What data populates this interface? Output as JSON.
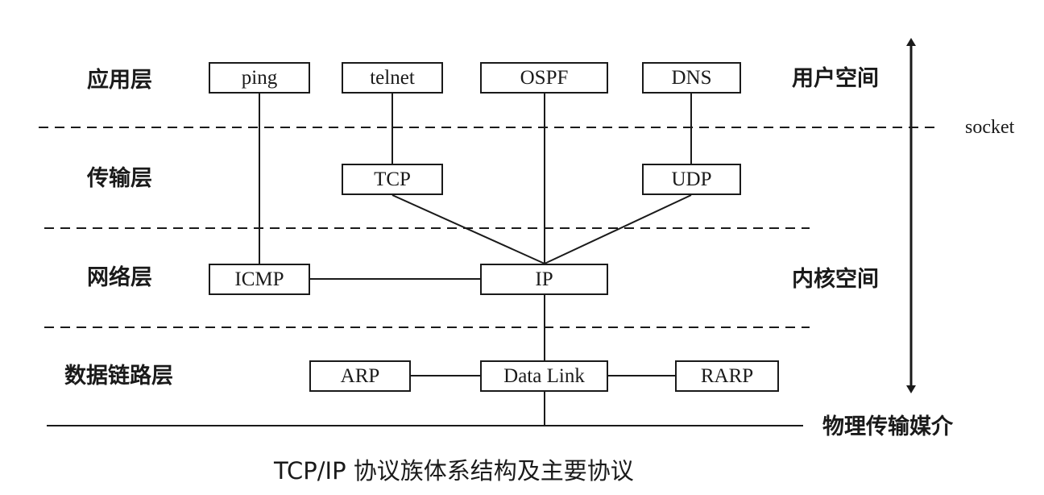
{
  "layers": {
    "application": "应用层",
    "transport": "传输层",
    "network": "网络层",
    "datalink": "数据链路层"
  },
  "side_labels": {
    "user_space": "用户空间",
    "socket": "socket",
    "kernel_space": "内核空间",
    "physical_medium": "物理传输媒介"
  },
  "boxes": {
    "ping": "ping",
    "telnet": "telnet",
    "ospf": "OSPF",
    "dns": "DNS",
    "tcp": "TCP",
    "udp": "UDP",
    "icmp": "ICMP",
    "ip": "IP",
    "arp": "ARP",
    "datalink": "Data Link",
    "rarp": "RARP"
  },
  "caption": "TCP/IP 协议族体系结构及主要协议",
  "colors": {
    "line": "#1a1a1a",
    "background": "#ffffff"
  }
}
